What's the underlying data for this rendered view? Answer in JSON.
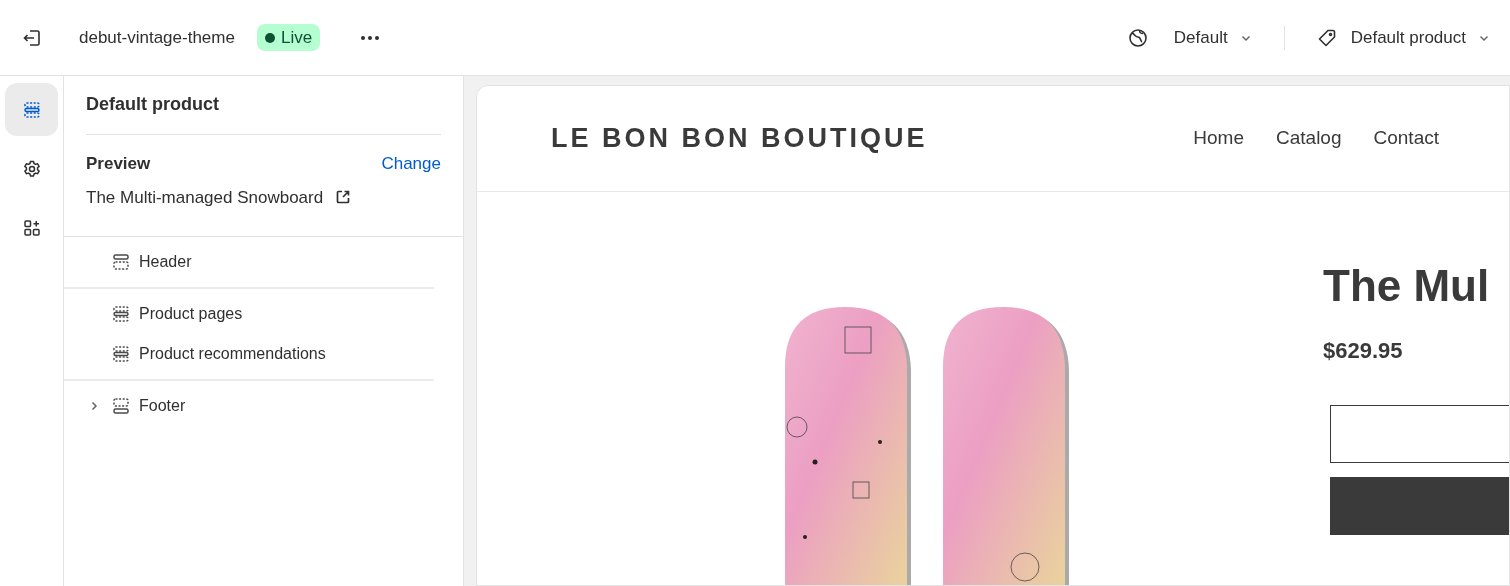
{
  "topbar": {
    "theme_name": "debut-vintage-theme",
    "status": "Live",
    "locale": "Default",
    "template": "Default product"
  },
  "rail": [
    {
      "kind": "sections",
      "selected": true
    },
    {
      "kind": "settings",
      "selected": false
    },
    {
      "kind": "apps",
      "selected": false
    }
  ],
  "panel": {
    "title": "Default product",
    "preview_label": "Preview",
    "change_link": "Change",
    "preview_product": "The Multi-managed Snowboard",
    "groups": [
      {
        "items": [
          {
            "label": "Header",
            "kind": "header"
          }
        ]
      },
      {
        "items": [
          {
            "label": "Product pages",
            "kind": "section"
          },
          {
            "label": "Product recommendations",
            "kind": "section"
          }
        ]
      },
      {
        "items": [
          {
            "label": "Footer",
            "kind": "footer",
            "expanded": false
          }
        ]
      }
    ]
  },
  "store": {
    "logo": "LE BON BON BOUTIQUE",
    "nav": [
      "Home",
      "Catalog",
      "Contact"
    ],
    "product_title": "The Mul",
    "price": "$629.95"
  }
}
